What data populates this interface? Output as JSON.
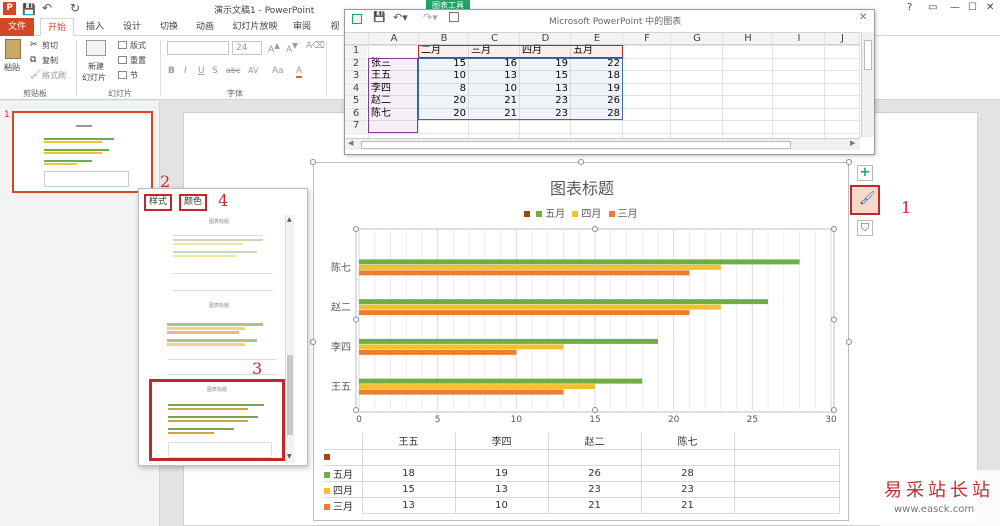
{
  "app": {
    "title": "演示文稿1 - PowerPoint",
    "context_tab": "图表工具",
    "window_controls": [
      "?",
      "▭",
      "—",
      "☐",
      "✕"
    ]
  },
  "tabs": [
    "文件",
    "开始",
    "插入",
    "设计",
    "切换",
    "动画",
    "幻灯片放映",
    "审阅",
    "视"
  ],
  "ribbon": {
    "paste": "粘贴",
    "cut": "剪切",
    "copy": "复制",
    "format_painter": "格式刷",
    "new_slide": "新建",
    "new_slide2": "幻灯片",
    "layout": "版式",
    "reset": "重置",
    "section": "节",
    "font_size": "24",
    "groups": [
      "剪贴板",
      "幻灯片",
      "字体"
    ],
    "font_buttons": [
      "B",
      "I",
      "U",
      "S",
      "abc",
      "AV",
      "Aa",
      "A"
    ]
  },
  "sheet": {
    "title": "Microsoft PowerPoint 中的图表",
    "col_headers": [
      "A",
      "B",
      "C",
      "D",
      "E",
      "F",
      "G",
      "H",
      "I",
      "J"
    ],
    "row_headers": [
      "1",
      "2",
      "3",
      "4",
      "5",
      "6",
      "7"
    ],
    "header_row": [
      "",
      "二月",
      "三月",
      "四月",
      "五月"
    ],
    "rows": [
      {
        "name": "张三",
        "v": [
          "15",
          "16",
          "19",
          "22"
        ]
      },
      {
        "name": "王五",
        "v": [
          "10",
          "13",
          "15",
          "18"
        ]
      },
      {
        "name": "李四",
        "v": [
          "8",
          "10",
          "13",
          "19"
        ]
      },
      {
        "name": "赵二",
        "v": [
          "20",
          "21",
          "23",
          "26"
        ]
      },
      {
        "name": "陈七",
        "v": [
          "20",
          "21",
          "23",
          "28"
        ]
      }
    ]
  },
  "thumbnail": {
    "number": "1"
  },
  "style_pane": {
    "tab_style": "样式",
    "tab_color": "颜色",
    "num_style_tab": "2",
    "num_color_tab": "4",
    "num_selected": "3",
    "thumb_titles": [
      "图表标题",
      "图表标题",
      "图表标题"
    ]
  },
  "side_buttons": {
    "add": "+",
    "num_brush": "1"
  },
  "chart_data": {
    "type": "bar",
    "title": "图表标题",
    "categories": [
      "陈七",
      "赵二",
      "李四",
      "王五"
    ],
    "series": [
      {
        "name": "五月",
        "color": "#70ad47",
        "values": [
          28,
          26,
          19,
          18
        ]
      },
      {
        "name": "四月",
        "color": "#f2c12e",
        "values": [
          23,
          23,
          13,
          15
        ]
      },
      {
        "name": "三月",
        "color": "#ed7d31",
        "values": [
          21,
          21,
          10,
          13
        ]
      }
    ],
    "legend": [
      "五月",
      "四月",
      "三月"
    ],
    "legend_extra_color": "#9e480e",
    "x_ticks": [
      "0",
      "5",
      "10",
      "15",
      "20",
      "25",
      "30"
    ],
    "xlim": [
      0,
      30
    ],
    "grid": true,
    "legend_position": "top",
    "table": {
      "columns": [
        "王五",
        "李四",
        "赵二",
        "陈七"
      ],
      "rows": [
        {
          "name": "",
          "values": [
            "",
            "",
            "",
            ""
          ]
        },
        {
          "name": "五月",
          "values": [
            "18",
            "19",
            "26",
            "28"
          ]
        },
        {
          "name": "四月",
          "values": [
            "15",
            "13",
            "23",
            "23"
          ]
        },
        {
          "name": "三月",
          "values": [
            "13",
            "10",
            "21",
            "21"
          ]
        }
      ]
    }
  },
  "watermark": {
    "text": "易采站长站",
    "url": "www.easck.com"
  }
}
